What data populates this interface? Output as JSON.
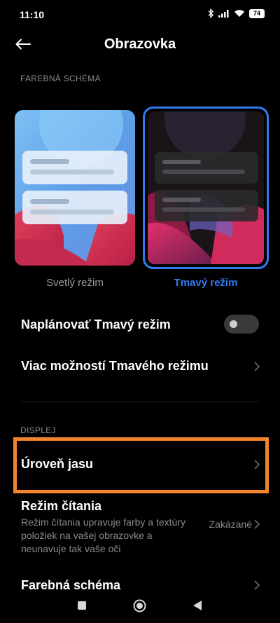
{
  "status": {
    "time": "11:10",
    "battery": "74"
  },
  "header": {
    "title": "Obrazovka"
  },
  "scheme_section": {
    "label": "FAREBNÁ SCHÉMA",
    "light_label": "Svetlý režim",
    "dark_label": "Tmavý režim",
    "selected": "dark"
  },
  "schedule_row": {
    "label": "Naplánovať Tmavý režim",
    "enabled": false
  },
  "dark_options_row": {
    "label": "Viac možností Tmavého režimu"
  },
  "display_section": {
    "label": "DISPLEJ"
  },
  "brightness_row": {
    "label": "Úroveň jasu"
  },
  "reading_row": {
    "label": "Režim čítania",
    "description": "Režim čítania upravuje farby a textúry položiek na vašej obrazovke a neunavuje tak vaše oči",
    "value": "Zakázané"
  },
  "color_scheme_row": {
    "label": "Farebná schéma"
  },
  "colors": {
    "accent": "#2f7bf0",
    "highlight": "#f4852a",
    "muted": "#8a8a8a"
  }
}
